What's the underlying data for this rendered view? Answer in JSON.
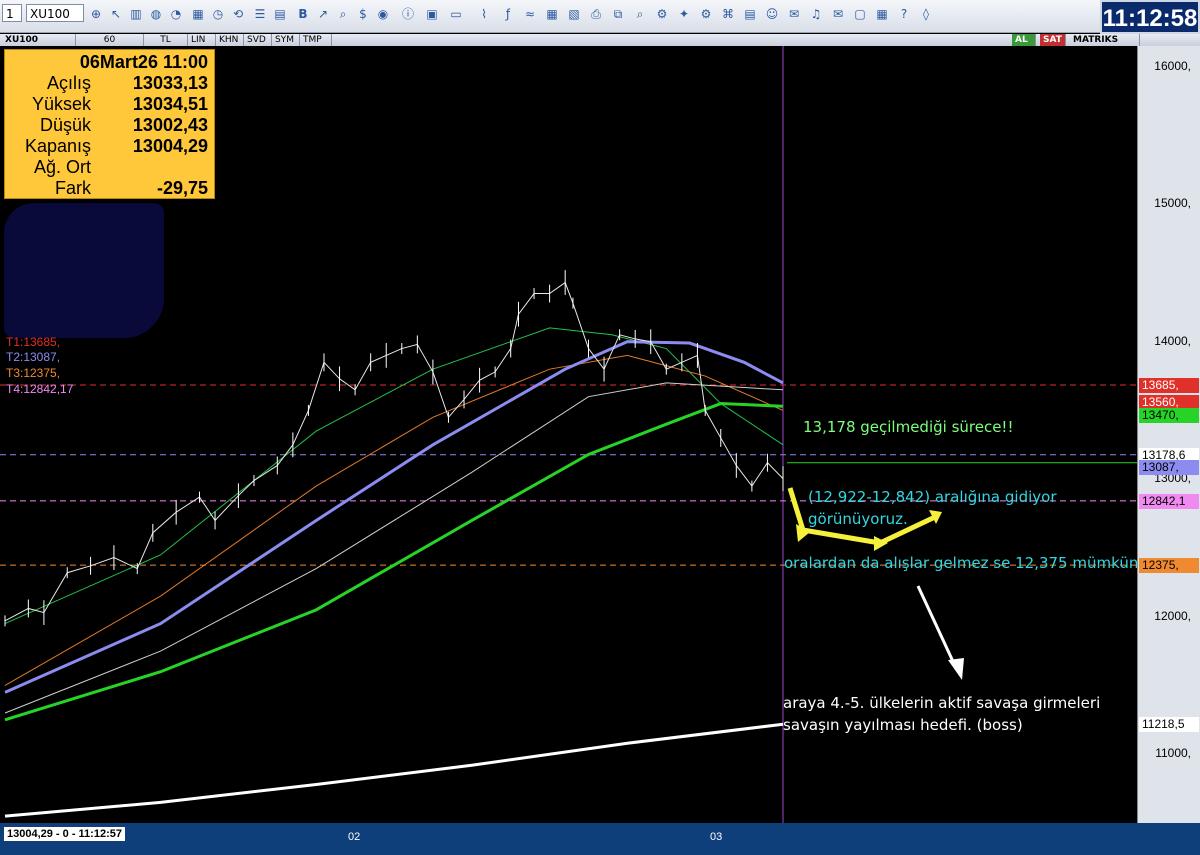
{
  "toolbar": {
    "symbol_select": "XU100",
    "left_select": "1",
    "clock": "11:12:58"
  },
  "chartbar": {
    "symbol": "XU100",
    "period": "60",
    "currency": "TL",
    "opts": [
      "LIN",
      "KHN",
      "SVD",
      "SYM",
      "TMP"
    ],
    "right_al": "AL",
    "right_sat": "SAT",
    "brand": "MATRIKS"
  },
  "infobox": {
    "date": "06Mart26 11:00",
    "rows": [
      {
        "label": "Açılış",
        "value": "13033,13"
      },
      {
        "label": "Yüksek",
        "value": "13034,51"
      },
      {
        "label": "Düşük",
        "value": "13002,43"
      },
      {
        "label": "Kapanış",
        "value": "13004,29"
      },
      {
        "label": "Ağ. Ort",
        "value": ""
      },
      {
        "label": "Fark",
        "value": "-29,75"
      }
    ]
  },
  "targets": {
    "t1": "T1:13685,",
    "t2": "T2:13087,",
    "t3": "T3:12375,",
    "t4": "T4:12842,17"
  },
  "status_bar": "13004,29 - 0 - 11:12:57",
  "colors": {
    "t1": "#e0302a",
    "t2": "#8b8bf0",
    "t3": "#f08a30",
    "t4": "#f08af0",
    "annotation_green": "#7cff7c",
    "annotation_cyan": "#33d6e0",
    "annotation_white": "#ffffff",
    "arrow_yellow": "#f5f03a"
  },
  "annotations": {
    "a1": "13,178 geçilmediği sürece!!",
    "a2_line1": "(12,922-12,842) aralığına gidiyor",
    "a2_line2": "görünüyoruz.",
    "a3": "oralardan da alışlar gelmez se 12,375  mümkün",
    "a4_line1": "araya 4.-5. ülkelerin aktif savaşa girmeleri",
    "a4_line2": "savaşın yayılması hedefi. (boss)"
  },
  "chart_data": {
    "type": "line",
    "symbol": "XU100",
    "period": "60",
    "y_ticks": [
      "16000,",
      "15000,",
      "14000,",
      "13000,",
      "12000,",
      "11000,"
    ],
    "y_range": [
      10500,
      16150
    ],
    "x_labels": [
      "02",
      "03"
    ],
    "price_close": [
      {
        "x": 0.0,
        "y": 11970
      },
      {
        "x": 0.03,
        "y": 12060
      },
      {
        "x": 0.05,
        "y": 12030
      },
      {
        "x": 0.08,
        "y": 12320
      },
      {
        "x": 0.11,
        "y": 12370
      },
      {
        "x": 0.14,
        "y": 12430
      },
      {
        "x": 0.17,
        "y": 12350
      },
      {
        "x": 0.19,
        "y": 12610
      },
      {
        "x": 0.22,
        "y": 12760
      },
      {
        "x": 0.25,
        "y": 12870
      },
      {
        "x": 0.27,
        "y": 12700
      },
      {
        "x": 0.3,
        "y": 12880
      },
      {
        "x": 0.32,
        "y": 12990
      },
      {
        "x": 0.35,
        "y": 13100
      },
      {
        "x": 0.37,
        "y": 13250
      },
      {
        "x": 0.39,
        "y": 13500
      },
      {
        "x": 0.41,
        "y": 13850
      },
      {
        "x": 0.43,
        "y": 13730
      },
      {
        "x": 0.45,
        "y": 13650
      },
      {
        "x": 0.47,
        "y": 13850
      },
      {
        "x": 0.49,
        "y": 13900
      },
      {
        "x": 0.51,
        "y": 13950
      },
      {
        "x": 0.53,
        "y": 13980
      },
      {
        "x": 0.55,
        "y": 13780
      },
      {
        "x": 0.57,
        "y": 13450
      },
      {
        "x": 0.59,
        "y": 13580
      },
      {
        "x": 0.61,
        "y": 13720
      },
      {
        "x": 0.63,
        "y": 13780
      },
      {
        "x": 0.65,
        "y": 13950
      },
      {
        "x": 0.66,
        "y": 14200
      },
      {
        "x": 0.68,
        "y": 14350
      },
      {
        "x": 0.7,
        "y": 14350
      },
      {
        "x": 0.72,
        "y": 14430
      },
      {
        "x": 0.73,
        "y": 14280
      },
      {
        "x": 0.75,
        "y": 13950
      },
      {
        "x": 0.77,
        "y": 13800
      },
      {
        "x": 0.79,
        "y": 14050
      },
      {
        "x": 0.81,
        "y": 14020
      },
      {
        "x": 0.83,
        "y": 14000
      },
      {
        "x": 0.85,
        "y": 13800
      },
      {
        "x": 0.87,
        "y": 13850
      },
      {
        "x": 0.89,
        "y": 13900
      },
      {
        "x": 0.9,
        "y": 13500
      },
      {
        "x": 0.92,
        "y": 13300
      },
      {
        "x": 0.94,
        "y": 13100
      },
      {
        "x": 0.96,
        "y": 12950
      },
      {
        "x": 0.98,
        "y": 13120
      },
      {
        "x": 1.0,
        "y": 13004
      }
    ],
    "moving_averages": [
      {
        "name": "ma_green_thin",
        "color": "#22c34a",
        "width": 1,
        "points": [
          [
            0,
            11950
          ],
          [
            0.2,
            12450
          ],
          [
            0.4,
            13350
          ],
          [
            0.55,
            13800
          ],
          [
            0.7,
            14100
          ],
          [
            0.78,
            14050
          ],
          [
            0.85,
            13950
          ],
          [
            0.92,
            13550
          ],
          [
            1.0,
            13250
          ]
        ]
      },
      {
        "name": "ma_orange",
        "color": "#e07a2a",
        "width": 1,
        "points": [
          [
            0,
            11500
          ],
          [
            0.2,
            12150
          ],
          [
            0.4,
            12950
          ],
          [
            0.55,
            13450
          ],
          [
            0.7,
            13800
          ],
          [
            0.8,
            13900
          ],
          [
            0.9,
            13750
          ],
          [
            1.0,
            13500
          ]
        ]
      },
      {
        "name": "ma_blue",
        "color": "#8c8cf0",
        "width": 3,
        "points": [
          [
            0,
            11450
          ],
          [
            0.2,
            11950
          ],
          [
            0.4,
            12700
          ],
          [
            0.55,
            13250
          ],
          [
            0.72,
            13800
          ],
          [
            0.8,
            14000
          ],
          [
            0.88,
            13990
          ],
          [
            0.95,
            13850
          ],
          [
            1.0,
            13700
          ]
        ]
      },
      {
        "name": "ma_white_thin",
        "color": "#cfcfcf",
        "width": 1,
        "points": [
          [
            0,
            11300
          ],
          [
            0.2,
            11750
          ],
          [
            0.4,
            12350
          ],
          [
            0.6,
            13050
          ],
          [
            0.75,
            13600
          ],
          [
            0.85,
            13700
          ],
          [
            1.0,
            13650
          ]
        ]
      },
      {
        "name": "ma_green_thick",
        "color": "#27d327",
        "width": 3,
        "points": [
          [
            0,
            11250
          ],
          [
            0.2,
            11600
          ],
          [
            0.4,
            12050
          ],
          [
            0.6,
            12700
          ],
          [
            0.75,
            13180
          ],
          [
            0.85,
            13400
          ],
          [
            0.92,
            13550
          ],
          [
            1.0,
            13530
          ]
        ]
      },
      {
        "name": "ma_white_thick",
        "color": "#ffffff",
        "width": 3,
        "points": [
          [
            0,
            10550
          ],
          [
            0.2,
            10650
          ],
          [
            0.4,
            10780
          ],
          [
            0.6,
            10920
          ],
          [
            0.8,
            11080
          ],
          [
            1.0,
            11218
          ]
        ]
      }
    ],
    "hlines": [
      {
        "value": 13685,
        "color": "#e0302a",
        "label": "13685,"
      },
      {
        "value": 13178,
        "color": "#8b8bf0",
        "label": "13178,6"
      },
      {
        "value": 12842,
        "color": "#f08af0",
        "label": "12842,1"
      },
      {
        "value": 12375,
        "color": "#f08a30",
        "label": "12375,"
      }
    ],
    "right_labels": [
      {
        "value": 13685,
        "text": "13685,",
        "bg": "#e0302a",
        "fg": "#ffffff"
      },
      {
        "value": 13560,
        "text": "13560,",
        "bg": "#e0302a",
        "fg": "#ffffff"
      },
      {
        "value": 13470,
        "text": "13470,",
        "bg": "#27d327",
        "fg": "#000000"
      },
      {
        "value": 13178,
        "text": "13178,6",
        "bg": "#ffffff",
        "fg": "#000000"
      },
      {
        "value": 13087,
        "text": "13087,",
        "bg": "#8b8bf0",
        "fg": "#000000"
      },
      {
        "value": 12842,
        "text": "12842,1",
        "bg": "#f08af0",
        "fg": "#000000"
      },
      {
        "value": 12375,
        "text": "12375,",
        "bg": "#f08a30",
        "fg": "#000000"
      },
      {
        "value": 11218,
        "text": "11218,5",
        "bg": "#ffffff",
        "fg": "#000000"
      }
    ]
  }
}
